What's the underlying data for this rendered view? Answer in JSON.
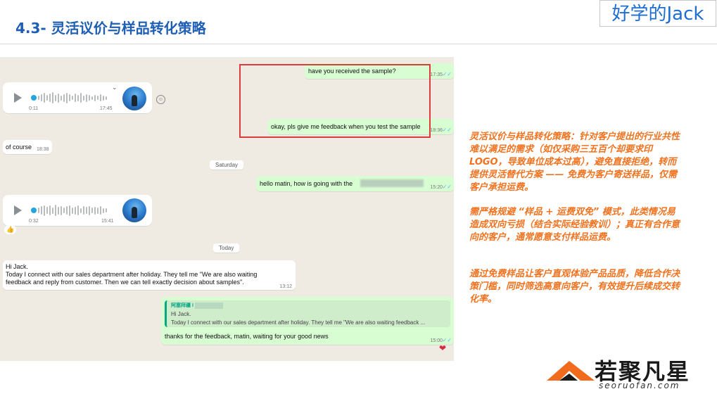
{
  "slide": {
    "title": "4.3- 灵活议价与样品转化策略",
    "brand_box": "好学的Jack"
  },
  "chat": {
    "messages": {
      "received_sample": {
        "text": "have you received the sample?",
        "time": "17:35"
      },
      "feedback_request": {
        "text": "okay, pls give me feedback when you test the sample",
        "time": "18:36"
      },
      "voice1": {
        "duration": "0:11",
        "time": "17:45"
      },
      "of_course": {
        "text": "of course",
        "time": "18:38"
      },
      "date_saturday": "Saturday",
      "hello_matin": {
        "text": "hello matin, how is going with the",
        "time": "15:20"
      },
      "voice2": {
        "duration": "0:32",
        "time": "15:41"
      },
      "reaction_thumb": "👍",
      "date_today": "Today",
      "hi_jack": {
        "line1": "Hi Jack.",
        "line2": "Today I connect with our sales department after holiday. They tell me \"We are also waiting",
        "line3": "feedback and reply from customer. Then we can tell exactly decision about samples\".",
        "time": "13:12"
      },
      "reply": {
        "quote_name": "阿塞拜疆 I",
        "quote_line1": "Hi Jack.",
        "quote_line2": "Today I connect with our sales department after holiday. They tell me \"We are also waiting feedback ...",
        "text": "thanks for the feedback, matin, waiting for your good news",
        "time": "15:00"
      },
      "reaction_heart": "❤"
    }
  },
  "notes": {
    "p1": "灵活议价与样品转化策略：针对客户提出的行业共性难以满足的需求（如仅采购三五百个却要求印 LOGO，导致单位成本过高），避免直接拒绝，转而提供灵活替代方案 —— 免费为客户寄送样品，仅需客户承担运费。",
    "p2": "需严格规避 “样品 + 运费双免” 模式，此类情况易造成双向亏损（结合实际经验教训）；真正有合作意向的客户，通常愿意支付样品运费。",
    "p3": "通过免费样品让客户直观体验产品品质，降低合作决策门槛，同时筛选高意向客户，有效提升后续成交转化率。"
  },
  "logo": {
    "name": "若聚凡星",
    "url": "seoruofan.com"
  },
  "colors": {
    "title_blue": "#1e5fb4",
    "note_orange": "#f1721f",
    "highlight_red": "#e03b3b",
    "chat_bg": "#efeae2",
    "outgoing_bubble": "#d9fdd3"
  }
}
